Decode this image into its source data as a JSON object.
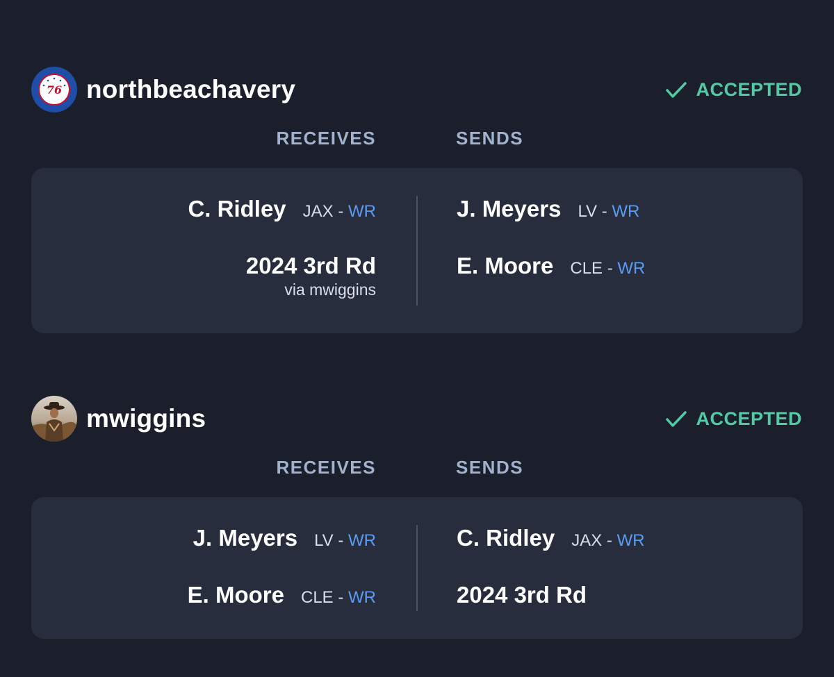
{
  "trades": [
    {
      "user": {
        "name": "northbeachavery",
        "avatar": "76ers-logo-avatar"
      },
      "status": {
        "label": "ACCEPTED",
        "icon": "check-icon",
        "color": "#52cba5"
      },
      "headers": {
        "receives": "RECEIVES",
        "sends": "SENDS"
      },
      "receives": [
        {
          "name": "C. Ridley",
          "team": "JAX",
          "sep": "-",
          "pos": "WR"
        },
        {
          "name": "2024 3rd Rd",
          "via": "via mwiggins"
        }
      ],
      "sends": [
        {
          "name": "J. Meyers",
          "team": "LV",
          "sep": "-",
          "pos": "WR"
        },
        {
          "name": "E. Moore",
          "team": "CLE",
          "sep": "-",
          "pos": "WR"
        }
      ]
    },
    {
      "user": {
        "name": "mwiggins",
        "avatar": "cowboy-photo-avatar"
      },
      "status": {
        "label": "ACCEPTED",
        "icon": "check-icon",
        "color": "#52cba5"
      },
      "headers": {
        "receives": "RECEIVES",
        "sends": "SENDS"
      },
      "receives": [
        {
          "name": "J. Meyers",
          "team": "LV",
          "sep": "-",
          "pos": "WR"
        },
        {
          "name": "E. Moore",
          "team": "CLE",
          "sep": "-",
          "pos": "WR"
        }
      ],
      "sends": [
        {
          "name": "C. Ridley",
          "team": "JAX",
          "sep": "-",
          "pos": "WR"
        },
        {
          "name": "2024 3rd Rd"
        }
      ]
    }
  ],
  "colors": {
    "background": "#1b1f2c",
    "card": "#272d3d",
    "accepted": "#52cba5",
    "position": "#5b9cf4",
    "header": "#a2b2cc"
  }
}
